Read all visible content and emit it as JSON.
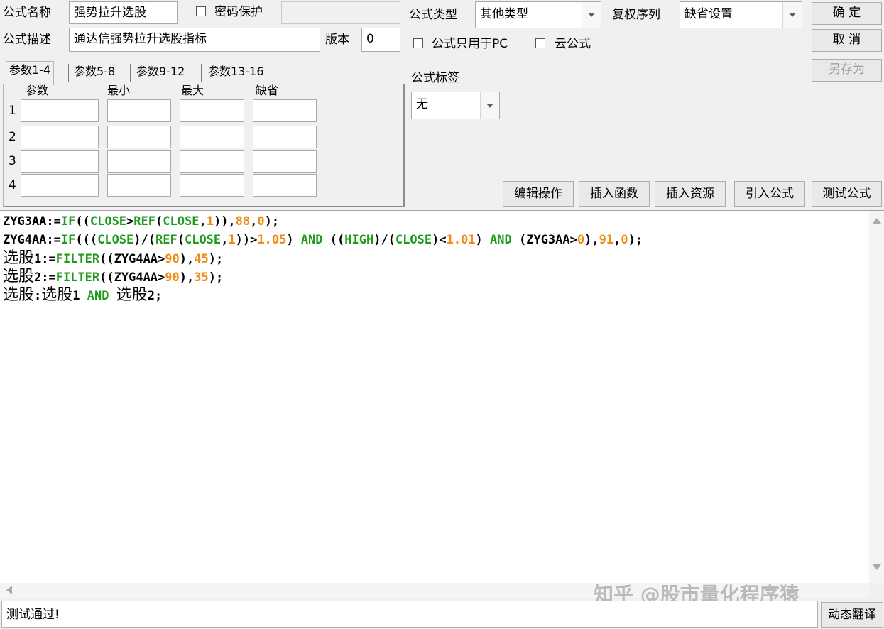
{
  "formula": {
    "name_label": "公式名称",
    "name_value": "强势拉升选股",
    "password_label": "密码保护",
    "desc_label": "公式描述",
    "desc_value": "通达信强势拉升选股指标",
    "version_label": "版本",
    "version_value": "0",
    "type_label": "公式类型",
    "type_value": "其他类型",
    "rights_label": "复权序列",
    "rights_value": "缺省设置",
    "pc_only_label": "公式只用于PC",
    "cloud_label": "云公式",
    "tag_label": "公式标签",
    "tag_value": "无"
  },
  "buttons": {
    "ok": "确  定",
    "cancel": "取  消",
    "save_as": "另存为",
    "edit_ops": "编辑操作",
    "insert_func": "插入函数",
    "insert_res": "插入资源",
    "import_formula": "引入公式",
    "test_formula": "测试公式",
    "dynamic_translate": "动态翻译"
  },
  "params": {
    "tabs": [
      "参数1-4",
      "参数5-8",
      "参数9-12",
      "参数13-16"
    ],
    "headers": [
      "参数",
      "最小",
      "最大",
      "缺省"
    ],
    "rows": [
      "1",
      "2",
      "3",
      "4"
    ]
  },
  "code": {
    "line1": [
      {
        "t": "ZYG3AA:=",
        "c": "k"
      },
      {
        "t": "IF",
        "c": "f"
      },
      {
        "t": "((",
        "c": "k"
      },
      {
        "t": "CLOSE",
        "c": "f"
      },
      {
        "t": ">",
        "c": "k"
      },
      {
        "t": "REF",
        "c": "f"
      },
      {
        "t": "(",
        "c": "k"
      },
      {
        "t": "CLOSE",
        "c": "f"
      },
      {
        "t": ",",
        "c": "k"
      },
      {
        "t": "1",
        "c": "n"
      },
      {
        "t": ")),",
        "c": "k"
      },
      {
        "t": "88",
        "c": "n"
      },
      {
        "t": ",",
        "c": "k"
      },
      {
        "t": "0",
        "c": "n"
      },
      {
        "t": ");",
        "c": "k"
      }
    ],
    "line2": [
      {
        "t": "ZYG4AA:=",
        "c": "k"
      },
      {
        "t": "IF",
        "c": "f"
      },
      {
        "t": "(((",
        "c": "k"
      },
      {
        "t": "CLOSE",
        "c": "f"
      },
      {
        "t": ")/(",
        "c": "k"
      },
      {
        "t": "REF",
        "c": "f"
      },
      {
        "t": "(",
        "c": "k"
      },
      {
        "t": "CLOSE",
        "c": "f"
      },
      {
        "t": ",",
        "c": "k"
      },
      {
        "t": "1",
        "c": "n"
      },
      {
        "t": "))>",
        "c": "k"
      },
      {
        "t": "1.05",
        "c": "n"
      },
      {
        "t": ") ",
        "c": "k"
      },
      {
        "t": "AND",
        "c": "f"
      },
      {
        "t": " ((",
        "c": "k"
      },
      {
        "t": "HIGH",
        "c": "f"
      },
      {
        "t": ")/(",
        "c": "k"
      },
      {
        "t": "CLOSE",
        "c": "f"
      },
      {
        "t": ")<",
        "c": "k"
      },
      {
        "t": "1.01",
        "c": "n"
      },
      {
        "t": ") ",
        "c": "k"
      },
      {
        "t": "AND",
        "c": "f"
      },
      {
        "t": " (ZYG3AA>",
        "c": "k"
      },
      {
        "t": "0",
        "c": "n"
      },
      {
        "t": "),",
        "c": "k"
      },
      {
        "t": "91",
        "c": "n"
      },
      {
        "t": ",",
        "c": "k"
      },
      {
        "t": "0",
        "c": "n"
      },
      {
        "t": ");",
        "c": "k"
      }
    ],
    "line3": [
      {
        "t": "选股",
        "c": "cjk"
      },
      {
        "t": "1:=",
        "c": "k"
      },
      {
        "t": "FILTER",
        "c": "f"
      },
      {
        "t": "((ZYG4AA>",
        "c": "k"
      },
      {
        "t": "90",
        "c": "n"
      },
      {
        "t": "),",
        "c": "k"
      },
      {
        "t": "45",
        "c": "n"
      },
      {
        "t": ");",
        "c": "k"
      }
    ],
    "line4": [
      {
        "t": "选股",
        "c": "cjk"
      },
      {
        "t": "2:=",
        "c": "k"
      },
      {
        "t": "FILTER",
        "c": "f"
      },
      {
        "t": "((ZYG4AA>",
        "c": "k"
      },
      {
        "t": "90",
        "c": "n"
      },
      {
        "t": "),",
        "c": "k"
      },
      {
        "t": "35",
        "c": "n"
      },
      {
        "t": ");",
        "c": "k"
      }
    ],
    "line5": [
      {
        "t": "选股",
        "c": "cjk"
      },
      {
        "t": ":",
        "c": "k"
      },
      {
        "t": "选股",
        "c": "cjk"
      },
      {
        "t": "1 ",
        "c": "k"
      },
      {
        "t": "AND",
        "c": "f"
      },
      {
        "t": " ",
        "c": "k"
      },
      {
        "t": "选股",
        "c": "cjk"
      },
      {
        "t": "2;",
        "c": "k"
      }
    ]
  },
  "status": {
    "message": "测试通过!",
    "watermark": "知乎 @股市量化程序猿"
  },
  "colors": {
    "function": "#1e9a1e",
    "number": "#ef8a12",
    "background": "#f0f0f0"
  }
}
